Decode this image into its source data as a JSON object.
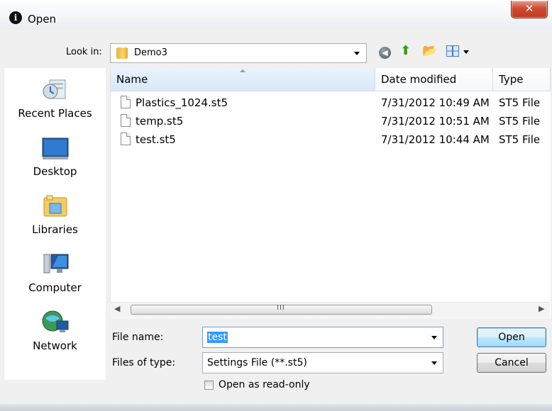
{
  "window": {
    "title": "Open",
    "app_icon": "i",
    "close_glyph": "✕"
  },
  "toolbar": {
    "lookin_label": "Look in:",
    "lookin_value": "Demo3",
    "back_glyph": "◀",
    "up_glyph": "⬆",
    "newfolder_glyph": "📂"
  },
  "sidebar": {
    "items": [
      {
        "label": "Recent Places",
        "icon": "recent-places-icon"
      },
      {
        "label": "Desktop",
        "icon": "desktop-icon"
      },
      {
        "label": "Libraries",
        "icon": "libraries-icon"
      },
      {
        "label": "Computer",
        "icon": "computer-icon"
      },
      {
        "label": "Network",
        "icon": "network-icon"
      }
    ]
  },
  "filelist": {
    "columns": [
      "Name",
      "Date modified",
      "Type"
    ],
    "rows": [
      {
        "name": "Plastics_1024.st5",
        "date": "7/31/2012 10:49 AM",
        "type": "ST5 File"
      },
      {
        "name": "temp.st5",
        "date": "7/31/2012 10:51 AM",
        "type": "ST5 File"
      },
      {
        "name": "test.st5",
        "date": "7/31/2012 10:44 AM",
        "type": "ST5 File"
      }
    ],
    "scroll_grip": "III",
    "scroll_left": "◀",
    "scroll_right": "▶"
  },
  "form": {
    "filename_label": "File name:",
    "filename_value": "test",
    "filetype_label": "Files of type:",
    "filetype_value": "Settings File (**.st5)",
    "readonly_label": "Open as read-only"
  },
  "buttons": {
    "open": "Open",
    "cancel": "Cancel"
  },
  "colors": {
    "selection": "#3399ff",
    "close_button": "#c9442a"
  }
}
